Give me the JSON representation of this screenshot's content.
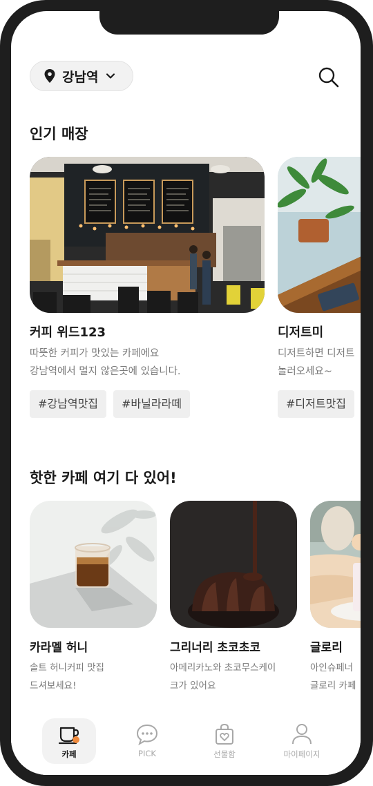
{
  "header": {
    "location": "강남역",
    "location_icon": "map-pin-icon",
    "dropdown_icon": "chevron-down-icon",
    "search_icon": "search-icon"
  },
  "popular": {
    "title": "인기 매장",
    "cards": [
      {
        "name": "커피 위드123",
        "desc_line1": "따뜻한 커피가 맛있는 카페에요",
        "desc_line2": "강남역에서 멀지 않은곳에 있습니다.",
        "tags": [
          "#강남역맛집",
          "#바닐라라떼"
        ]
      },
      {
        "name": "디저트미",
        "desc_line1": "디저트하면 디저트",
        "desc_line2": "놀러오세요~",
        "tags": [
          "#디저트맛집"
        ]
      }
    ]
  },
  "hot": {
    "title": "핫한 카페 여기 다 있어!",
    "cards": [
      {
        "name": "카라멜 허니",
        "desc_line1": "솔트 허니커피 맛집",
        "desc_line2": "드셔보세요!"
      },
      {
        "name": "그리너리 초코초코",
        "desc_line1": "아메리카노와 초코무스케이",
        "desc_line2": "크가 있어요"
      },
      {
        "name": "글로리",
        "desc_line1": "아인슈페너",
        "desc_line2": "글로리 카페"
      }
    ]
  },
  "tabbar": {
    "tabs": [
      {
        "label": "카페",
        "icon": "coffee-cup-icon",
        "active": true
      },
      {
        "label": "PICK",
        "icon": "chat-bubble-icon",
        "active": false
      },
      {
        "label": "선물함",
        "icon": "gift-bag-icon",
        "active": false
      },
      {
        "label": "마이페이지",
        "icon": "user-icon",
        "active": false
      }
    ]
  },
  "colors": {
    "frame": "#1e1e1e",
    "text": "#1a1a1a",
    "muted": "#7a7a7a",
    "tag_bg": "#efefef",
    "accent_dot": "#f08a3c"
  }
}
